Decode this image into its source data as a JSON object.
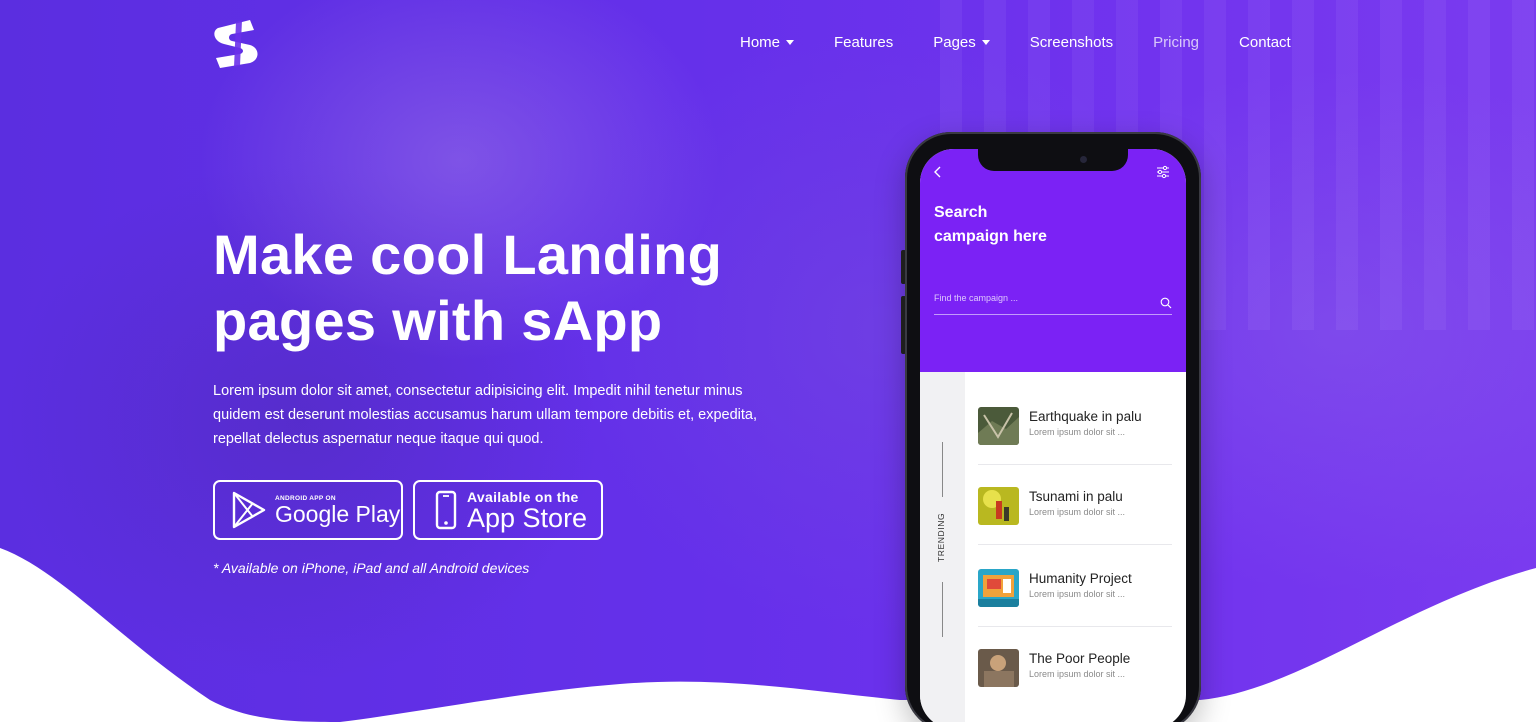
{
  "brand": {
    "logo_letter": "S",
    "logo_alt": "sApp logo"
  },
  "nav": {
    "items": [
      {
        "label": "Home",
        "dropdown": true
      },
      {
        "label": "Features",
        "dropdown": false
      },
      {
        "label": "Pages",
        "dropdown": true
      },
      {
        "label": "Screenshots",
        "dropdown": false
      },
      {
        "label": "Pricing",
        "dropdown": false,
        "muted": true
      },
      {
        "label": "Contact",
        "dropdown": false
      }
    ]
  },
  "hero": {
    "headline_line1": "Make cool Landing",
    "headline_line2": "pages with sApp",
    "lead": "Lorem ipsum dolor sit amet, consectetur adipisicing elit. Impedit nihil tenetur minus quidem est deserunt molestias accusamus harum ullam tempore debitis et, expedita, repellat delectus aspernatur neque itaque qui quod.",
    "google_play": {
      "small": "ANDROID APP ON",
      "big": "Google Play"
    },
    "app_store": {
      "small": "Available on the",
      "big": "App Store"
    },
    "note": "* Available on iPhone, iPad and all Android devices"
  },
  "phone": {
    "title_line1": "Search",
    "title_line2": "campaign here",
    "search_placeholder": "Find the campaign ...",
    "sidebar_label": "TRENDING",
    "items": [
      {
        "title": "Earthquake in palu",
        "sub": "Lorem ipsum dolor sit ..."
      },
      {
        "title": "Tsunami in palu",
        "sub": "Lorem ipsum dolor sit ..."
      },
      {
        "title": "Humanity Project",
        "sub": "Lorem ipsum dolor sit ..."
      },
      {
        "title": "The Poor People",
        "sub": "Lorem ipsum dolor sit ..."
      }
    ]
  },
  "colors": {
    "hero_left": "#5b2ee0",
    "hero_right": "#7a3bef",
    "phone_accent": "#7b22f5",
    "white": "#ffffff"
  },
  "icons": [
    "logo-s-icon",
    "chevron-down-icon",
    "google-play-icon",
    "iphone-icon",
    "back-arrow-icon",
    "filter-sliders-icon",
    "search-icon"
  ]
}
